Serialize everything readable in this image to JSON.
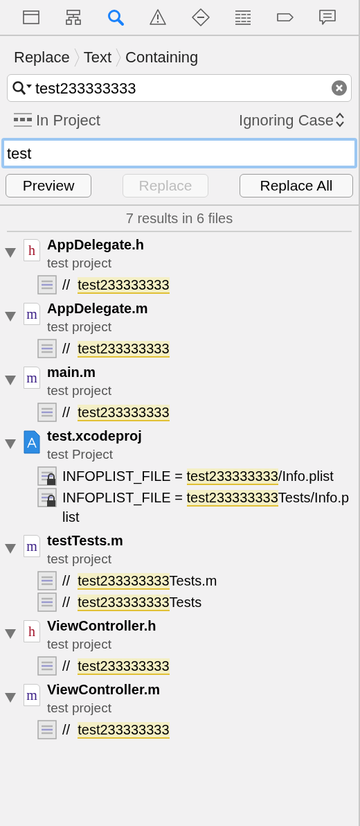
{
  "navigator_tabs": [
    {
      "kind": "folder",
      "selected": false
    },
    {
      "kind": "hierarchy",
      "selected": false
    },
    {
      "kind": "search",
      "selected": true
    },
    {
      "kind": "warning",
      "selected": false
    },
    {
      "kind": "breakpoint",
      "selected": false
    },
    {
      "kind": "list",
      "selected": false
    },
    {
      "kind": "tag",
      "selected": false
    },
    {
      "kind": "chat",
      "selected": false
    }
  ],
  "breadcrumb": [
    "Replace",
    "Text",
    "Containing"
  ],
  "search_field": {
    "value": "test233333333"
  },
  "scope": "In Project",
  "case_option": "Ignoring Case",
  "replace_field": {
    "value": "test"
  },
  "buttons": [
    {
      "label": "Preview",
      "disabled": false
    },
    {
      "label": "Replace",
      "disabled": true
    },
    {
      "label": "Replace All",
      "disabled": false
    }
  ],
  "summary": "7 results in 6 files",
  "results": [
    {
      "kind": "source",
      "icon_letter": "h",
      "name": "AppDelegate.h",
      "project": "test project",
      "expanded": true,
      "matches": [
        {
          "kind": "code",
          "before": "//  ",
          "match": "test233333333"
        }
      ]
    },
    {
      "kind": "source",
      "icon_letter": "m",
      "name": "AppDelegate.m",
      "project": "test project",
      "expanded": true,
      "matches": [
        {
          "kind": "code",
          "before": "//  ",
          "match": "test233333333"
        }
      ]
    },
    {
      "kind": "source",
      "icon_letter": "m",
      "name": "main.m",
      "project": "test project",
      "expanded": true,
      "matches": [
        {
          "kind": "code",
          "before": "//  ",
          "match": "test233333333"
        }
      ]
    },
    {
      "kind": "project",
      "name": "test.xcodeproj",
      "project": "test Project",
      "expanded": true,
      "matches": [
        {
          "kind": "setting",
          "before": "INFOPLIST_FILE = ",
          "match": "test233333333",
          "after": "/Info.plist"
        },
        {
          "kind": "setting",
          "before": "INFOPLIST_FILE = ",
          "match": "test233333333",
          "after": "Tests/Info.plist"
        }
      ]
    },
    {
      "kind": "source",
      "icon_letter": "m",
      "name": "testTests.m",
      "project": "test project",
      "expanded": true,
      "matches": [
        {
          "kind": "code",
          "before": "//  ",
          "match": "test233333333",
          "after": "Tests.m"
        },
        {
          "kind": "code",
          "before": "//  ",
          "match": "test233333333",
          "after": "Tests"
        }
      ]
    },
    {
      "kind": "source",
      "icon_letter": "h",
      "name": "ViewController.h",
      "project": "test project",
      "expanded": true,
      "matches": [
        {
          "kind": "code",
          "before": "//  ",
          "match": "test233333333"
        }
      ]
    },
    {
      "kind": "source",
      "icon_letter": "m",
      "name": "ViewController.m",
      "project": "test project",
      "expanded": true,
      "matches": [
        {
          "kind": "code",
          "before": "//  ",
          "match": "test233333333"
        }
      ]
    }
  ]
}
